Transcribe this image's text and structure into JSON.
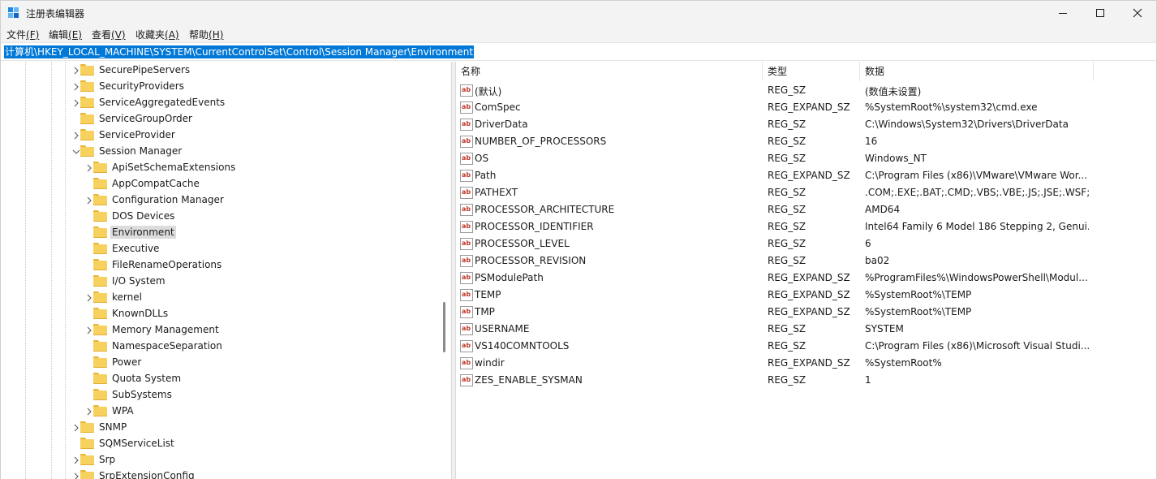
{
  "window": {
    "title": "注册表编辑器"
  },
  "menu": [
    {
      "label": "文件",
      "key": "(F)"
    },
    {
      "label": "编辑",
      "key": "(E)"
    },
    {
      "label": "查看",
      "key": "(V)"
    },
    {
      "label": "收藏夹",
      "key": "(A)"
    },
    {
      "label": "帮助",
      "key": "(H)"
    }
  ],
  "address": {
    "path": "计算机\\HKEY_LOCAL_MACHINE\\SYSTEM\\CurrentControlSet\\Control\\Session Manager\\Environment"
  },
  "tree": {
    "items": [
      {
        "label": "SecurePipeServers",
        "level": 1,
        "expander": "collapsed"
      },
      {
        "label": "SecurityProviders",
        "level": 1,
        "expander": "collapsed"
      },
      {
        "label": "ServiceAggregatedEvents",
        "level": 1,
        "expander": "collapsed"
      },
      {
        "label": "ServiceGroupOrder",
        "level": 1,
        "expander": "none"
      },
      {
        "label": "ServiceProvider",
        "level": 1,
        "expander": "collapsed"
      },
      {
        "label": "Session Manager",
        "level": 1,
        "expander": "expanded"
      },
      {
        "label": "ApiSetSchemaExtensions",
        "level": 2,
        "expander": "collapsed"
      },
      {
        "label": "AppCompatCache",
        "level": 2,
        "expander": "none"
      },
      {
        "label": "Configuration Manager",
        "level": 2,
        "expander": "collapsed"
      },
      {
        "label": "DOS Devices",
        "level": 2,
        "expander": "none"
      },
      {
        "label": "Environment",
        "level": 2,
        "expander": "none",
        "selected": true
      },
      {
        "label": "Executive",
        "level": 2,
        "expander": "none"
      },
      {
        "label": "FileRenameOperations",
        "level": 2,
        "expander": "none"
      },
      {
        "label": "I/O System",
        "level": 2,
        "expander": "none"
      },
      {
        "label": "kernel",
        "level": 2,
        "expander": "collapsed"
      },
      {
        "label": "KnownDLLs",
        "level": 2,
        "expander": "none"
      },
      {
        "label": "Memory Management",
        "level": 2,
        "expander": "collapsed"
      },
      {
        "label": "NamespaceSeparation",
        "level": 2,
        "expander": "none"
      },
      {
        "label": "Power",
        "level": 2,
        "expander": "none"
      },
      {
        "label": "Quota System",
        "level": 2,
        "expander": "none"
      },
      {
        "label": "SubSystems",
        "level": 2,
        "expander": "none"
      },
      {
        "label": "WPA",
        "level": 2,
        "expander": "collapsed"
      },
      {
        "label": "SNMP",
        "level": 1,
        "expander": "collapsed"
      },
      {
        "label": "SQMServiceList",
        "level": 1,
        "expander": "none"
      },
      {
        "label": "Srp",
        "level": 1,
        "expander": "collapsed"
      },
      {
        "label": "SrpExtensionConfig",
        "level": 1,
        "expander": "collapsed"
      }
    ]
  },
  "list": {
    "columns": {
      "name": "名称",
      "type": "类型",
      "data": "数据"
    },
    "rows": [
      {
        "name": "(默认)",
        "type": "REG_SZ",
        "data": "(数值未设置)"
      },
      {
        "name": "ComSpec",
        "type": "REG_EXPAND_SZ",
        "data": "%SystemRoot%\\system32\\cmd.exe"
      },
      {
        "name": "DriverData",
        "type": "REG_SZ",
        "data": "C:\\Windows\\System32\\Drivers\\DriverData"
      },
      {
        "name": "NUMBER_OF_PROCESSORS",
        "type": "REG_SZ",
        "data": "16"
      },
      {
        "name": "OS",
        "type": "REG_SZ",
        "data": "Windows_NT"
      },
      {
        "name": "Path",
        "type": "REG_EXPAND_SZ",
        "data": "C:\\Program Files (x86)\\VMware\\VMware Wor..."
      },
      {
        "name": "PATHEXT",
        "type": "REG_SZ",
        "data": ".COM;.EXE;.BAT;.CMD;.VBS;.VBE;.JS;.JSE;.WSF;...."
      },
      {
        "name": "PROCESSOR_ARCHITECTURE",
        "type": "REG_SZ",
        "data": "AMD64"
      },
      {
        "name": "PROCESSOR_IDENTIFIER",
        "type": "REG_SZ",
        "data": "Intel64 Family 6 Model 186 Stepping 2, Genui..."
      },
      {
        "name": "PROCESSOR_LEVEL",
        "type": "REG_SZ",
        "data": "6"
      },
      {
        "name": "PROCESSOR_REVISION",
        "type": "REG_SZ",
        "data": "ba02"
      },
      {
        "name": "PSModulePath",
        "type": "REG_EXPAND_SZ",
        "data": "%ProgramFiles%\\WindowsPowerShell\\Modul..."
      },
      {
        "name": "TEMP",
        "type": "REG_EXPAND_SZ",
        "data": "%SystemRoot%\\TEMP"
      },
      {
        "name": "TMP",
        "type": "REG_EXPAND_SZ",
        "data": "%SystemRoot%\\TEMP"
      },
      {
        "name": "USERNAME",
        "type": "REG_SZ",
        "data": "SYSTEM"
      },
      {
        "name": "VS140COMNTOOLS",
        "type": "REG_SZ",
        "data": "C:\\Program Files (x86)\\Microsoft Visual Studi..."
      },
      {
        "name": "windir",
        "type": "REG_EXPAND_SZ",
        "data": "%SystemRoot%"
      },
      {
        "name": "ZES_ENABLE_SYSMAN",
        "type": "REG_SZ",
        "data": "1"
      }
    ],
    "value_icon": {
      "name": "string-value-icon",
      "glyph": "ab"
    }
  },
  "colors": {
    "selection": "#0078d7",
    "folder": "#f7d15e",
    "tree_selected": "#dcdcdc"
  }
}
